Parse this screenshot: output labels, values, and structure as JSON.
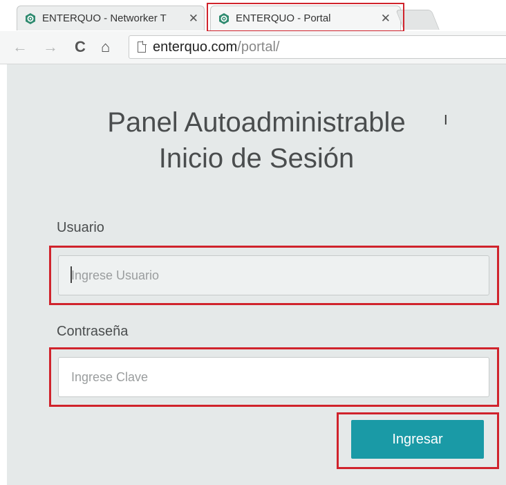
{
  "browser": {
    "tabs": [
      {
        "title": "ENTERQUO - Networker T",
        "close": "✕",
        "active": false
      },
      {
        "title": "ENTERQUO - Portal",
        "close": "✕",
        "active": true
      }
    ],
    "nav": {
      "back": "←",
      "forward": "→",
      "reload": "C",
      "home": "⌂"
    },
    "url": {
      "host": "enterquo.com",
      "path": "/portal/"
    }
  },
  "page": {
    "title_line1": "Panel Autoadministrable",
    "title_line2": "Inicio de Sesión",
    "username": {
      "label": "Usuario",
      "placeholder": "Ingrese Usuario",
      "value": ""
    },
    "password": {
      "label": "Contraseña",
      "placeholder": "Ingrese Clave",
      "value": ""
    },
    "submit_label": "Ingresar"
  },
  "colors": {
    "accent": "#1a9aa6",
    "highlight": "#d0232c",
    "page_background": "#e5e9e9"
  },
  "icons": {
    "favicon": "enterquo-favicon-icon",
    "page": "page-icon",
    "cursor": "text-cursor-icon"
  }
}
